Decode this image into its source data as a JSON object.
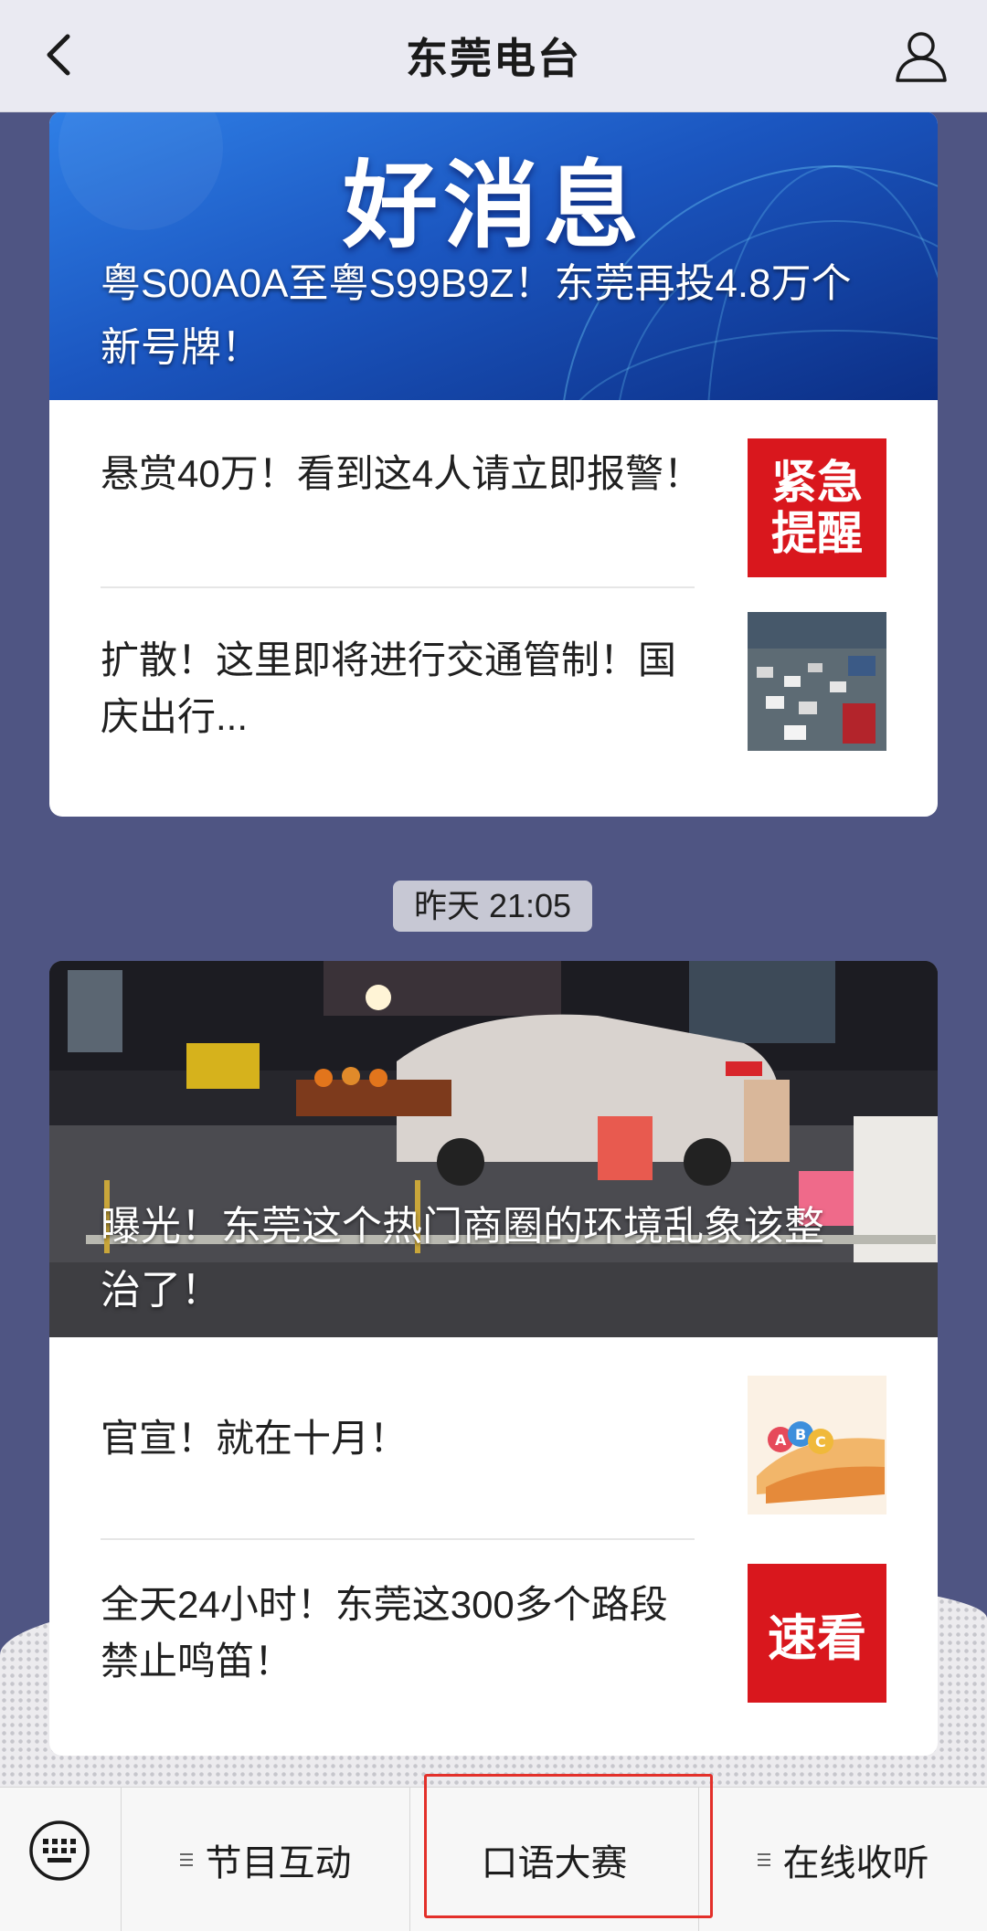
{
  "header": {
    "title": "东莞电台",
    "back_icon": "chevron-left-icon",
    "profile_icon": "user-icon"
  },
  "article1": {
    "banner_text": "好消息",
    "hero_title": "粤S00A0A至粤S99B9Z！东莞再投4.8万个新号牌！",
    "items": [
      {
        "text": "悬赏40万！看到这4人请立即报警！",
        "thumb_text": "紧急\n提醒"
      },
      {
        "text": "扩散！这里即将进行交通管制！国庆出行..."
      }
    ]
  },
  "timestamp": "昨天 21:05",
  "article2": {
    "hero_title": "曝光！东莞这个热门商圈的环境乱象该整治了！",
    "items": [
      {
        "text": "官宣！就在十月！"
      },
      {
        "text": "全天24小时！东莞这300多个路段禁止鸣笛！",
        "thumb_text": "速看"
      }
    ]
  },
  "bottom_bar": {
    "keyboard_icon": "keyboard-icon",
    "menus": [
      "节目互动",
      "口语大赛",
      "在线收听"
    ]
  },
  "colors": {
    "chat_bg": "#4f5583",
    "header_bg": "#eaeaf2",
    "accent_red": "#e3302a",
    "banner_blue": "#1f5fc4"
  }
}
